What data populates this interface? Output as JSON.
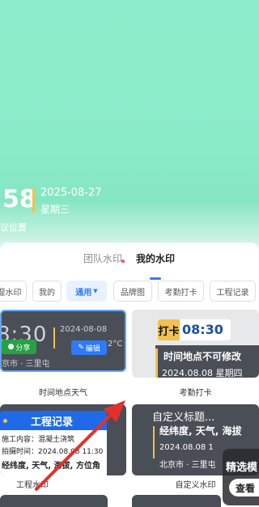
{
  "camera": {
    "time": "58",
    "date": "2025-08-27",
    "weekday": "星期三",
    "location": "议位置",
    "colors": {
      "bg": "#8aebc9",
      "accent_bar": "#f2c14e"
    }
  },
  "tabs": [
    {
      "label": "团队水印",
      "has_dot": true
    },
    {
      "label": "我的水印",
      "active": true
    }
  ],
  "filters": [
    {
      "label": "湿水印"
    },
    {
      "label": "我的"
    },
    {
      "label": "通用",
      "active": true,
      "icon": "caret-down-icon"
    },
    {
      "label": "品牌图"
    },
    {
      "label": "考勤打卡"
    },
    {
      "label": "工程记录"
    }
  ],
  "cards": [
    {
      "label": "时间地点天气",
      "time": "8:30",
      "date": "2024-08-08",
      "temp": "2°C",
      "location": "京市 · 三里屯",
      "share_label": "分享",
      "edit_label": "编辑",
      "selected": true
    },
    {
      "label": "考勤打卡",
      "punch": "打卡",
      "time": "08:30",
      "line1": "时间地点不可修改",
      "line2": "2024.08.08 星期四"
    },
    {
      "label": "工程水印",
      "title": "工程记录",
      "line1": "施工内容：混凝土浇筑",
      "line2": "拍摄时间：2024.08.08 11:30",
      "line3": "经纬度, 天气, 海拔, 方位角"
    },
    {
      "label": "自定义水印",
      "title": "自定义标题...",
      "subtitle": "经纬度, 天气, 海拔",
      "date": "2024.08.08  1",
      "location": "北京市 · 三里屯"
    }
  ],
  "popup": {
    "title": "精选模",
    "button": "查看"
  }
}
